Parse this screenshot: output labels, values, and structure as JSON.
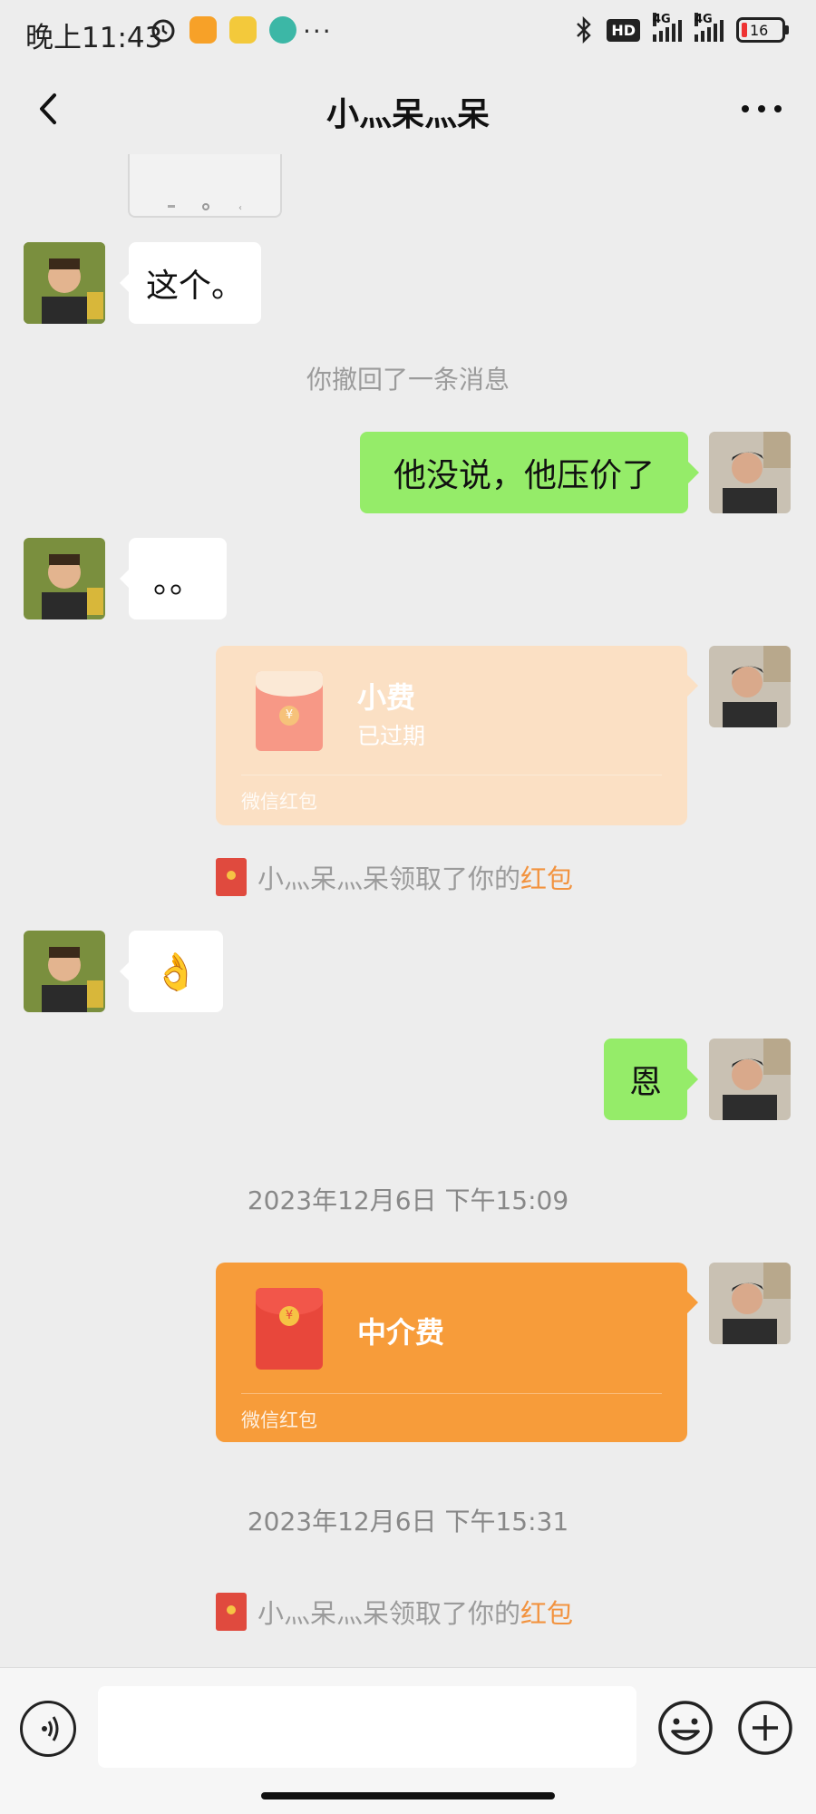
{
  "status": {
    "time": "晚上11:43",
    "network_label": "4G",
    "hd_label": "HD",
    "battery": "16",
    "dots": "···"
  },
  "nav": {
    "title": "小灬呆灬呆",
    "back_icon": "chevron-left-icon",
    "more_icon": "more-icon"
  },
  "messages": {
    "m1": "这个。",
    "recalled": "你撤回了一条消息",
    "m2": "他没说，他压价了",
    "m3": "。。",
    "rp1": {
      "title": "小费",
      "status": "已过期",
      "footer": "微信红包"
    },
    "notice1": {
      "prefix": "小灬呆灬呆领取了你的",
      "highlight": "红包"
    },
    "m4_emoji": "👌",
    "m5": "恩",
    "time1": "2023年12月6日 下午15:09",
    "rp2": {
      "title": "中介费",
      "footer": "微信红包"
    },
    "time2": "2023年12月6日 下午15:31",
    "notice2": {
      "prefix": "小灬呆灬呆领取了你的",
      "highlight": "红包"
    }
  },
  "colors": {
    "bg": "#ededed",
    "green_bubble": "#95ec69",
    "rp_active": "#f79c3a",
    "rp_expired": "#fbe0c4",
    "highlight": "#f2933f"
  },
  "input": {
    "voice_icon": "voice-icon",
    "emoji_icon": "emoji-icon",
    "plus_icon": "plus-icon"
  }
}
